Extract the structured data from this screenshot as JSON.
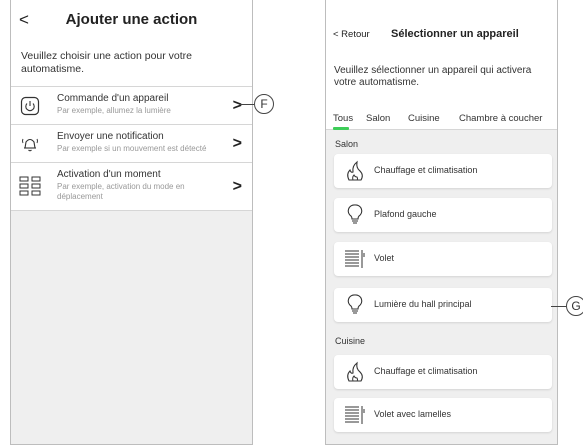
{
  "left": {
    "back_glyph": "<",
    "title": "Ajouter une action",
    "intro": "Veuillez choisir une action pour votre automatisme.",
    "actions": [
      {
        "icon": "power-icon",
        "title": "Commande d'un appareil",
        "subtitle": "Par exemple, allumez la lumière"
      },
      {
        "icon": "bell-icon",
        "title": "Envoyer une notification",
        "subtitle": "Par exemple si un mouvement est détecté"
      },
      {
        "icon": "grid-icon",
        "title": "Activation d'un moment",
        "subtitle": "Par exemple, activation du mode en déplacement"
      }
    ],
    "callout": "F"
  },
  "right": {
    "back_label": "< Retour",
    "title": "Sélectionner un appareil",
    "intro": "Veuillez sélectionner un appareil qui activera votre automatisme.",
    "tabs": [
      "Tous",
      "Salon",
      "Cuisine",
      "Chambre à coucher"
    ],
    "active_tab": "Tous",
    "accent_color": "#3dcd58",
    "sections": [
      {
        "label": "Salon",
        "devices": [
          {
            "icon": "flame-icon",
            "name": "Chauffage et climatisation"
          },
          {
            "icon": "lightbulb-icon",
            "name": "Plafond gauche"
          },
          {
            "icon": "shutter-icon",
            "name": "Volet"
          },
          {
            "icon": "lightbulb-icon",
            "name": "Lumière du hall principal"
          }
        ]
      },
      {
        "label": "Cuisine",
        "devices": [
          {
            "icon": "flame-icon",
            "name": "Chauffage et climatisation"
          },
          {
            "icon": "shutter-icon",
            "name": "Volet avec lamelles"
          }
        ]
      }
    ],
    "callout": "G"
  }
}
